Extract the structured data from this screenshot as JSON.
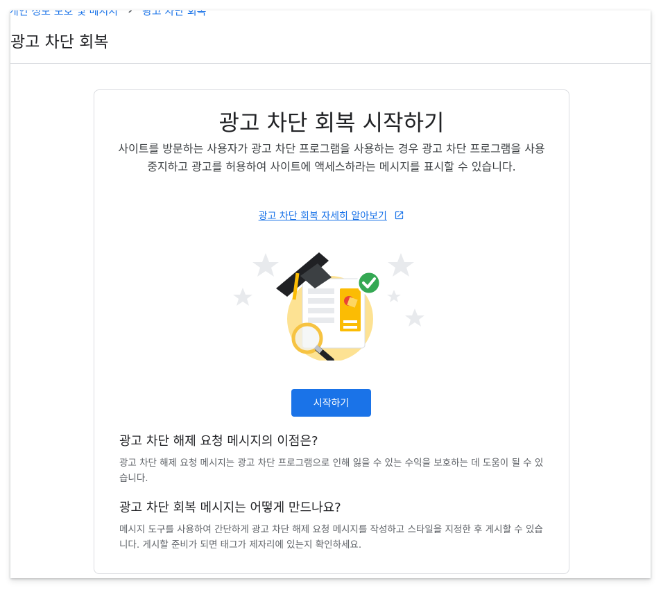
{
  "breadcrumb": {
    "parent": "개인 정보 보호 및 메시지",
    "current": "광고 차단 회복"
  },
  "page": {
    "title": "광고 차단 회복"
  },
  "card": {
    "title": "광고 차단 회복 시작하기",
    "description": "사이트를 방문하는 사용자가 광고 차단 프로그램을 사용하는 경우 광고 차단 프로그램을 사용 중지하고 광고를 허용하여 사이트에 액세스하라는 메시지를 표시할 수 있습니다.",
    "learn_more": "광고 차단 회복 자세히 알아보기",
    "start_button": "시작하기"
  },
  "faq": [
    {
      "question": "광고 차단 해제 요청 메시지의 이점은?",
      "answer": "광고 차단 해제 요청 메시지는 광고 차단 프로그램으로 인해 잃을 수 있는 수익을 보호하는 데 도움이 될 수 있습니다."
    },
    {
      "question": "광고 차단 회복 메시지는 어떻게 만드나요?",
      "answer": "메시지 도구를 사용하여 간단하게 광고 차단 해제 요청 메시지를 작성하고 스타일을 지정한 후 게시할 수 있습니다. 게시할 준비가 되면 태그가 제자리에 있는지 확인하세요."
    }
  ],
  "colors": {
    "accent": "#1a73e8",
    "success": "#34a853",
    "highlight": "#fbbc04"
  }
}
